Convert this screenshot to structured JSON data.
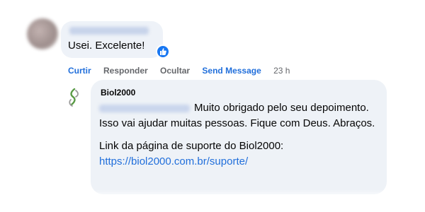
{
  "comment": {
    "text": "Usei. Excelente!",
    "reaction_icon": "thumbs-up-icon",
    "actions": {
      "like": "Curtir",
      "reply": "Responder",
      "hide": "Ocultar",
      "send_message": "Send Message",
      "time": "23 h"
    }
  },
  "reply": {
    "author": "Biol2000",
    "avatar_icon": "biol2000-logo-icon",
    "text_line1": "Muito obrigado pelo seu depoimento. Isso vai ajudar muitas pessoas. Fique com Deus. Abraços.",
    "text_line2": "Link da página de suporte do Biol2000:",
    "link": "https://biol2000.com.br/suporte/"
  },
  "colors": {
    "link_blue": "#216fdb",
    "like_blue": "#1877f2",
    "bubble_bg": "#eef2f7",
    "meta_gray": "#65676b"
  }
}
